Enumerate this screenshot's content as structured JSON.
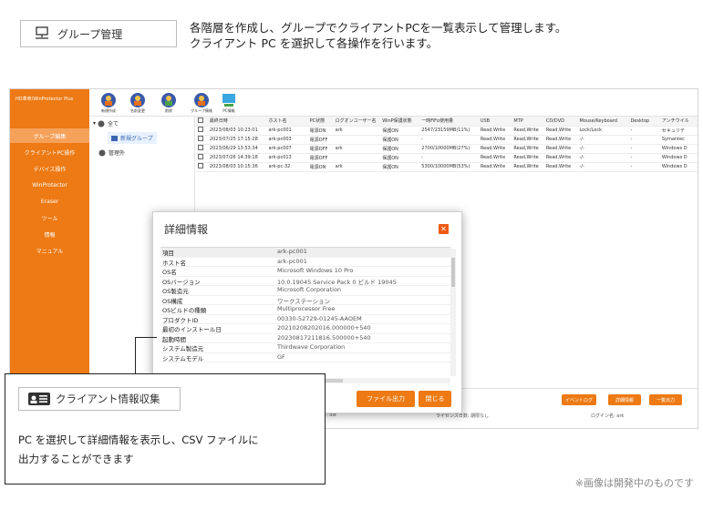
{
  "badge": {
    "label": "グループ管理",
    "icon": "network-icon"
  },
  "intro": {
    "line1": "各階層を作成し、グループでクライアントPCを一覧表示して管理します。",
    "line2": "クライアント PC を選択して各操作を行います。"
  },
  "app": {
    "product_title": "HD革命/WinProtector Plus",
    "sidebar_items": [
      "グループ編集",
      "クライアントPC操作",
      "デバイス操作",
      "WinProtector",
      "Eraser",
      "ツール",
      "情報",
      "マニュアル"
    ],
    "selected_index": 0,
    "toolbar": [
      "新規作成",
      "名前変更",
      "削除",
      "グループ情報",
      "PC情報"
    ],
    "tree": {
      "root": "全て",
      "group": "新規グループ",
      "unmanaged": "管理外"
    },
    "grid_headers": [
      "最終日時",
      "ホスト名",
      "PC状態",
      "ログオンユーザー名",
      "WinP保護状態",
      "一時FiFo使用量",
      "USB",
      "MTP",
      "CD/DVD",
      "Mouse/Keyboard",
      "Desktop",
      "アンチウイル"
    ],
    "grid_rows": [
      [
        "2023/08/03 10:23:01",
        "ark-pc001",
        "電源ON",
        "ark",
        "保護ON",
        "2547/23159MB(11%)",
        "Read,Write",
        "Read,Write",
        "Read,Write",
        "Lock/Lock",
        "-",
        "セキュリテ"
      ],
      [
        "2023/07/25 17:15:28",
        "ark-pc003",
        "電源OFF",
        "",
        "保護ON",
        "-",
        "Read,Write",
        "Read,Write",
        "Read,Write",
        "-/-",
        "-",
        "Symantec"
      ],
      [
        "2023/06/29 13:53:34",
        "ark-pc007",
        "電源OFF",
        "ark",
        "保護ON",
        "2700/10000MB(27%)",
        "Read,Write",
        "Read,Write",
        "Read,Write",
        "-/-",
        "-",
        "Windows D"
      ],
      [
        "2023/07/26 14:39:18",
        "ark-pc013",
        "電源OFF",
        "",
        "保護ON",
        "-",
        "Read,Write",
        "Read,Write",
        "Read,Write",
        "-/-",
        "-",
        "Windows D"
      ],
      [
        "2023/08/03 10:15:36",
        "ark-pc-32",
        "電源ON",
        "ark",
        "保護ON",
        "5300/10000MB(53%)",
        "Read,Write",
        "Read,Write",
        "Read,Write",
        "-/-",
        "-",
        "Windows D"
      ]
    ],
    "bottom_buttons": [
      "イベントログ",
      "詳細情報",
      "一覧出力"
    ],
    "status": {
      "left": ": ost",
      "license": "ライセンス日数: 期限なし",
      "login": "ログイン名: ark"
    }
  },
  "modal": {
    "title": "詳細情報",
    "rows": [
      [
        "項目",
        "ark-pc001"
      ],
      [
        "ホスト名",
        "ark-pc001"
      ],
      [
        "OS名",
        "Microsoft Windows 10 Pro"
      ],
      [
        "OSバージョン",
        "10.0.19045 Service Pack 0 ビルド 19045"
      ],
      [
        "OS製造元",
        "Microsoft Corporation"
      ],
      [
        "OS構成",
        "ワークステーション"
      ],
      [
        "OSビルドの種類",
        "Multiprocessor Free"
      ],
      [
        "プロダクトID",
        "00330-52729-01245-AAOEM"
      ],
      [
        "最初のインストール日",
        "20210208202016.000000+540"
      ],
      [
        "起動時間",
        "20230817211816.500000+540"
      ],
      [
        "システム製造元",
        "Thirdwave Corporation"
      ],
      [
        "システムモデル",
        "GF"
      ]
    ],
    "export_label": "ファイル出力",
    "close_label": "閉じる"
  },
  "callout": {
    "label": "クライアント情報収集",
    "icon": "id-card-icon",
    "desc_line1": "PC を選択して詳細情報を表示し、CSV ファイルに",
    "desc_line2": "出力することができます"
  },
  "footnote": "※画像は開発中のものです",
  "colors": {
    "accent": "#ed7a14",
    "sidebar_selected": "#f6a15a"
  }
}
